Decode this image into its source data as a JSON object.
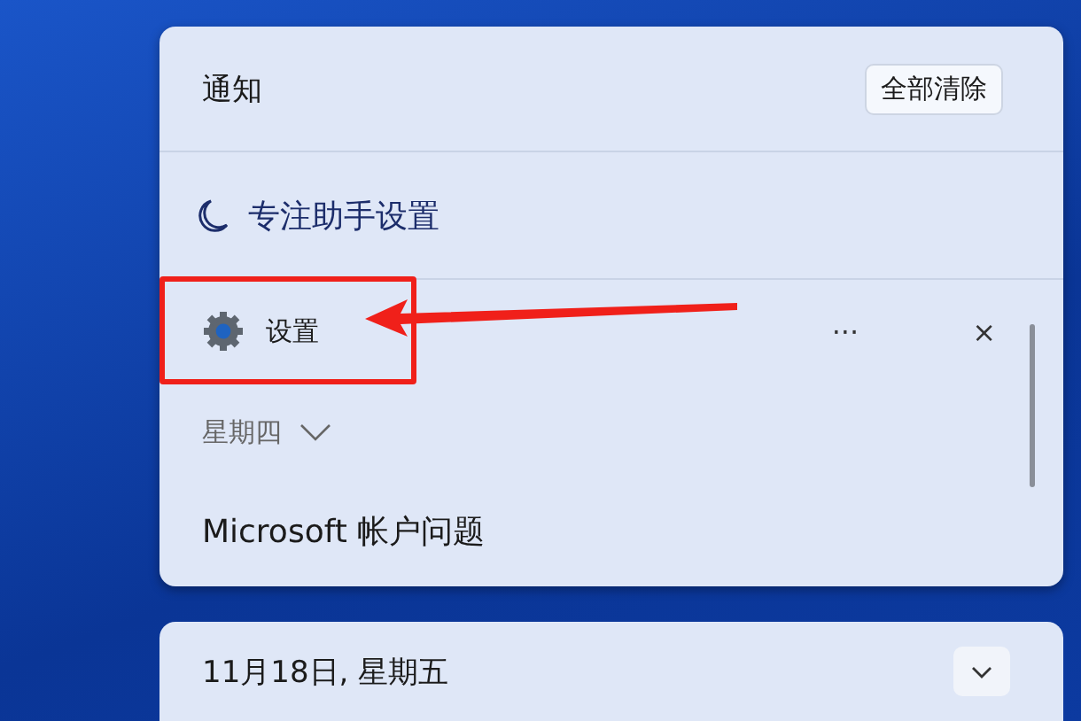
{
  "notification_center": {
    "title": "通知",
    "clear_all_button": "全部清除",
    "focus_assist_link": "专注助手设置",
    "app_group": {
      "app_name": "设置",
      "more_button": "···",
      "close_button": "×"
    },
    "day_group": {
      "label": "星期四",
      "expanded": true
    },
    "notification": {
      "title": "Microsoft 帐户问题"
    }
  },
  "calendar": {
    "date": "11月18日, 星期五",
    "expanded": false
  },
  "annotation": {
    "highlight": true,
    "arrow": true
  }
}
